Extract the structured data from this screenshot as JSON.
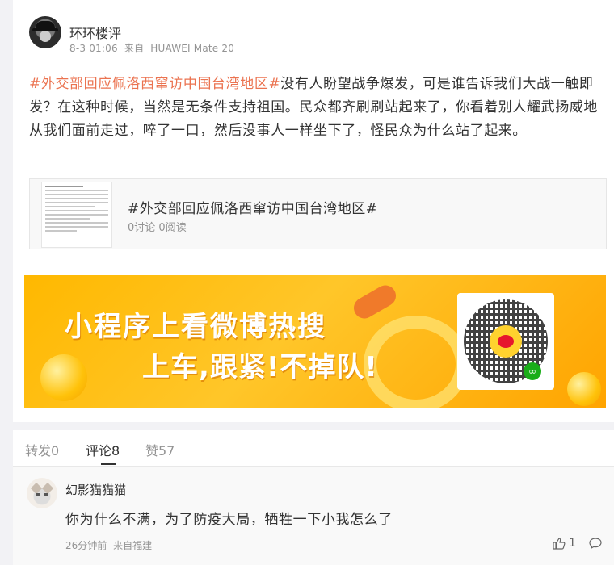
{
  "post": {
    "author": "环环楼评",
    "time": "8-3 01:06",
    "source_prefix": "来自",
    "device": "HUAWEI Mate 20",
    "hashtag": "#外交部回应佩洛西窜访中国台湾地区#",
    "body": "没有人盼望战争爆发，可是谁告诉我们大战一触即发？在这种时候，当然是无条件支持祖国。民众都齐刷刷站起来了，你看着别人耀武扬威地从我们面前走过，啐了一口，然后没事人一样坐下了，怪民众为什么站了起来。"
  },
  "topic_card": {
    "title": "#外交部回应佩洛西窜访中国台湾地区#",
    "discussions": "0讨论",
    "reads": "0阅读"
  },
  "banner": {
    "line1": "小程序上看微博热搜",
    "line2": "上车,跟紧!不掉队!"
  },
  "tabs": {
    "forward": "转发0",
    "comment": "评论8",
    "like": "赞57"
  },
  "comment": {
    "name": "幻影猫猫猫",
    "text": "你为什么不满，为了防疫大局，牺牲一下小我怎么了",
    "time": "26分钟前",
    "source": "来自福建",
    "likes": "1"
  },
  "colors": {
    "hashtag": "#eb7350",
    "banner": "#ffb800"
  },
  "icons": [
    "author-avatar",
    "thumbs-up-icon",
    "reply-icon",
    "qr-code",
    "weibo-logo-icon"
  ]
}
